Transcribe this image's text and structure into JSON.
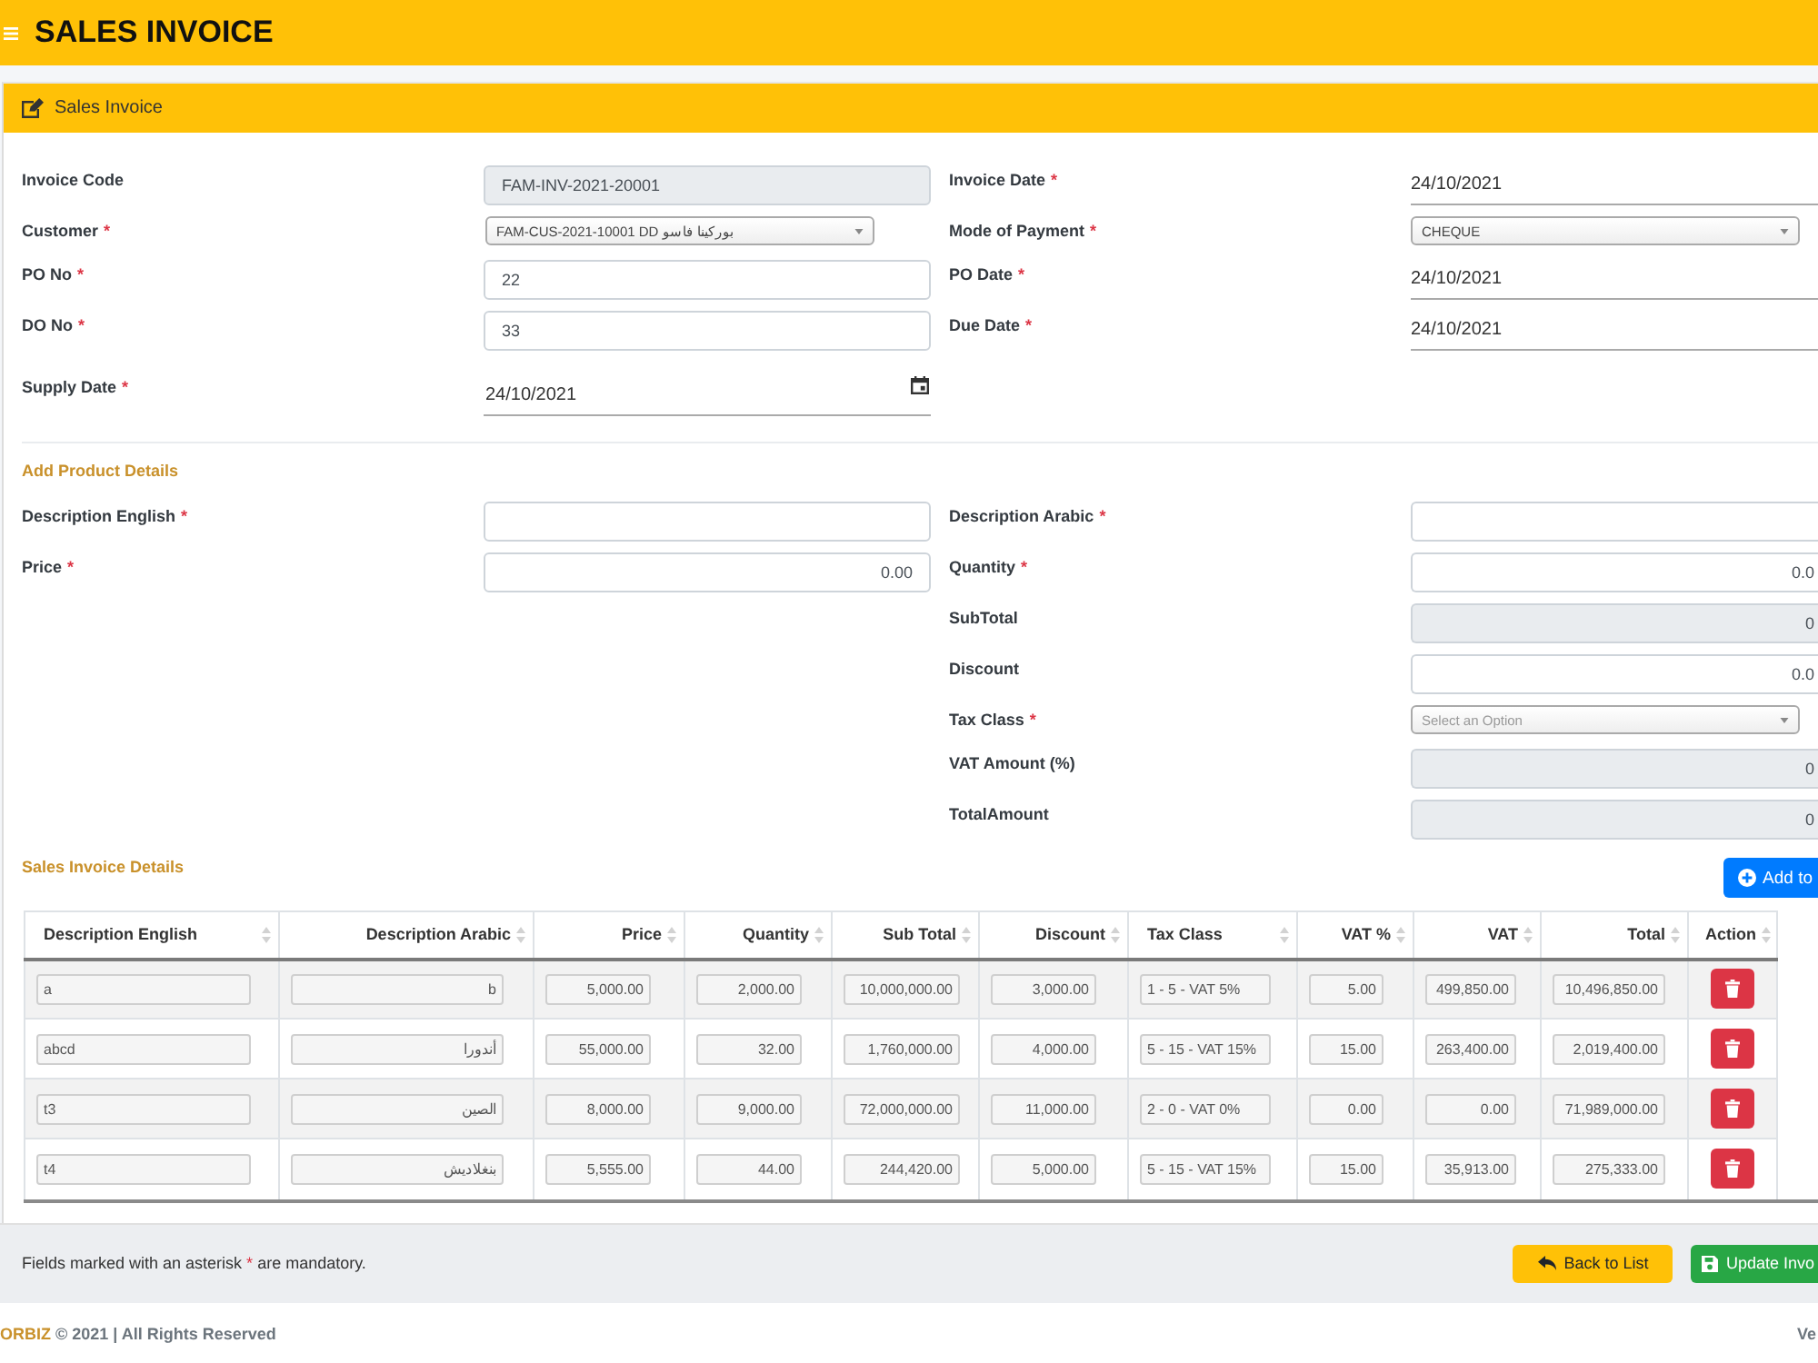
{
  "header": {
    "title": "SALES INVOICE"
  },
  "required_mark": "*",
  "card": {
    "title": "Sales Invoice"
  },
  "invoice_form": {
    "left": [
      {
        "label": "Invoice Code",
        "required": false,
        "kind": "readonly",
        "value": "FAM-INV-2021-20001"
      },
      {
        "label": "Customer",
        "required": true,
        "kind": "select",
        "value": "FAM-CUS-2021-10001 DD بوركينا فاسو"
      },
      {
        "label": "PO No",
        "required": true,
        "kind": "text",
        "value": "22"
      },
      {
        "label": "DO No",
        "required": true,
        "kind": "text",
        "value": "33"
      },
      {
        "label": "Supply Date",
        "required": true,
        "kind": "date-picker",
        "value": "24/10/2021"
      }
    ],
    "right": [
      {
        "label": "Invoice Date",
        "required": true,
        "kind": "date",
        "value": "24/10/2021"
      },
      {
        "label": "Mode of Payment",
        "required": true,
        "kind": "select",
        "value": "CHEQUE"
      },
      {
        "label": "PO Date",
        "required": true,
        "kind": "date",
        "value": "24/10/2021"
      },
      {
        "label": "Due Date",
        "required": true,
        "kind": "date",
        "value": "24/10/2021"
      }
    ]
  },
  "product_section": {
    "title": "Add Product Details",
    "left": [
      {
        "label": "Description English",
        "required": true,
        "kind": "text"
      },
      {
        "label": "Price",
        "required": true,
        "kind": "number",
        "value": "0.00"
      }
    ],
    "right": [
      {
        "label": "Description Arabic",
        "required": true,
        "kind": "text"
      },
      {
        "label": "Quantity",
        "required": true,
        "kind": "number",
        "value": "0.0"
      },
      {
        "label": "SubTotal",
        "required": false,
        "kind": "readonly-number",
        "value": "0"
      },
      {
        "label": "Discount",
        "required": false,
        "kind": "number",
        "value": "0.0"
      },
      {
        "label": "Tax Class",
        "required": true,
        "kind": "select",
        "placeholder": "Select an Option"
      },
      {
        "label": "VAT Amount (%)",
        "required": false,
        "kind": "readonly-number",
        "value": "0"
      },
      {
        "label": "TotalAmount",
        "required": false,
        "kind": "readonly-number",
        "value": "0"
      }
    ]
  },
  "details_section": {
    "title": "Sales Invoice Details",
    "add_button": "Add to"
  },
  "table": {
    "columns": [
      {
        "label": "Description English",
        "kind": "text"
      },
      {
        "label": "Description Arabic",
        "kind": "arabic"
      },
      {
        "label": "Price",
        "kind": "number"
      },
      {
        "label": "Quantity",
        "kind": "number"
      },
      {
        "label": "Sub Total",
        "kind": "number"
      },
      {
        "label": "Discount",
        "kind": "number"
      },
      {
        "label": "Tax Class",
        "kind": "text"
      },
      {
        "label": "VAT %",
        "kind": "number"
      },
      {
        "label": "VAT",
        "kind": "number"
      },
      {
        "label": "Total",
        "kind": "number"
      },
      {
        "label": "Action",
        "kind": "action"
      }
    ],
    "rows": [
      {
        "cells": [
          "a",
          "b",
          "5,000.00",
          "2,000.00",
          "10,000,000.00",
          "3,000.00",
          "1 - 5 - VAT 5%",
          "5.00",
          "499,850.00",
          "10,496,850.00"
        ]
      },
      {
        "cells": [
          "abcd",
          "أندورا",
          "55,000.00",
          "32.00",
          "1,760,000.00",
          "4,000.00",
          "5 - 15 - VAT 15%",
          "15.00",
          "263,400.00",
          "2,019,400.00"
        ]
      },
      {
        "cells": [
          "t3",
          "الصين",
          "8,000.00",
          "9,000.00",
          "72,000,000.00",
          "11,000.00",
          "2 - 0 - VAT 0%",
          "0.00",
          "0.00",
          "71,989,000.00"
        ]
      },
      {
        "cells": [
          "t4",
          "بنغلاديش",
          "5,555.00",
          "44.00",
          "244,420.00",
          "5,000.00",
          "5 - 15 - VAT 15%",
          "15.00",
          "35,913.00",
          "275,333.00"
        ]
      }
    ]
  },
  "action_bar": {
    "note": {
      "before": "Fields marked with an asterisk",
      "mark": "*",
      "after": "are mandatory."
    },
    "buttons": [
      {
        "label": "Back to List",
        "kind": "back"
      },
      {
        "label": "Update Invo",
        "kind": "update"
      }
    ]
  },
  "footer": {
    "brand": "ORBIZ",
    "copyright": "© 2021 | All Rights Reserved",
    "version": "Ve"
  }
}
